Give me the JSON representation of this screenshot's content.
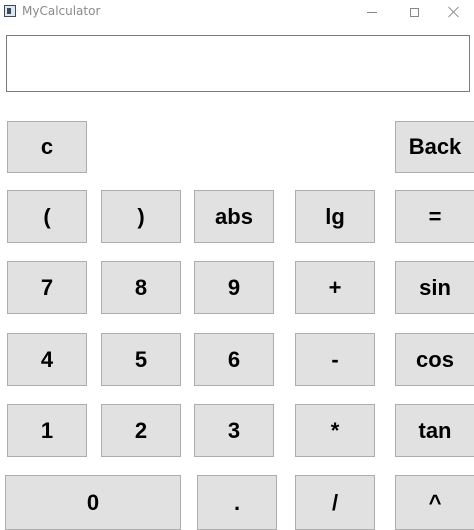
{
  "window": {
    "title": "MyCalculator",
    "minimize_label": "minimize",
    "maximize_label": "maximize",
    "close_label": "close"
  },
  "display": {
    "value": ""
  },
  "buttons": {
    "clear": "c",
    "back": "Back",
    "lparen": "(",
    "rparen": ")",
    "abs": "abs",
    "lg": "lg",
    "equals": "=",
    "seven": "7",
    "eight": "8",
    "nine": "9",
    "plus": "+",
    "sin": "sin",
    "four": "4",
    "five": "5",
    "six": "6",
    "minus": "-",
    "cos": "cos",
    "one": "1",
    "two": "2",
    "three": "3",
    "multiply": "*",
    "tan": "tan",
    "zero": "0",
    "dot": ".",
    "divide": "/",
    "power": "^"
  }
}
